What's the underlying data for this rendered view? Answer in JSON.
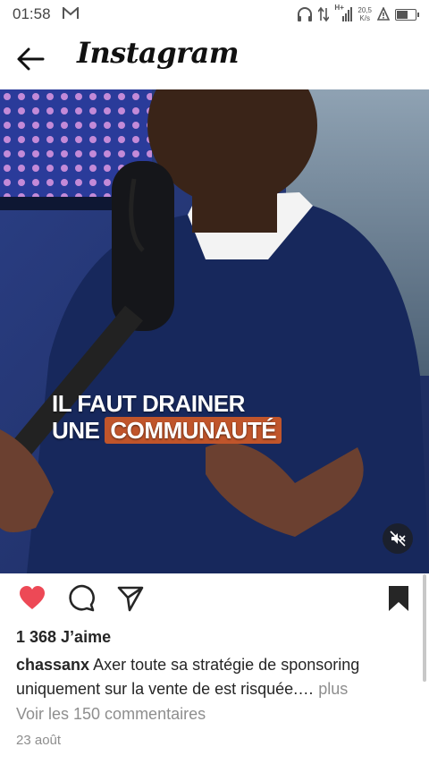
{
  "status_bar": {
    "time": "01:58",
    "network_type": "H+",
    "speed_value": "20,5",
    "speed_unit": "K/s"
  },
  "header": {
    "app_name": "Instagram"
  },
  "post": {
    "video_caption_line1": "IL FAUT DRAINER",
    "video_caption_line2_prefix": "UNE",
    "video_caption_line2_highlight": "COMMUNAUTÉ",
    "likes_text": "1 368 J’aime",
    "username": "chassanx",
    "caption": "Axer toute sa stratégie de sponsoring uniquement sur la vente de est risquée.…",
    "more_label": "plus",
    "comments_link": "Voir les 150 commentaires",
    "date": "23 août"
  },
  "colors": {
    "like_red": "#ed4956",
    "caption_highlight": "#c0552b"
  },
  "icons": [
    "mail-icon",
    "headphones-icon",
    "signal-icon",
    "alarm-icon",
    "battery-icon",
    "back-arrow-icon",
    "mute-icon",
    "heart-icon",
    "comment-icon",
    "share-icon",
    "bookmark-icon"
  ]
}
